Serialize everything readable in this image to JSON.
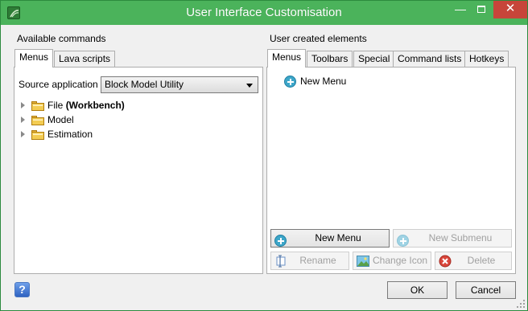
{
  "window": {
    "title": "User Interface Customisation",
    "minimize_glyph": "—",
    "close_glyph": "✕",
    "titlebar_color": "#4bb35b",
    "close_color": "#c7453a"
  },
  "left": {
    "section_label": "Available commands",
    "tabs": [
      {
        "label": "Menus",
        "active": true
      },
      {
        "label": "Lava scripts",
        "active": false
      }
    ],
    "source_label": "Source application",
    "source_value": "Block Model Utility",
    "tree": [
      {
        "label": "File",
        "suffix": "(Workbench)"
      },
      {
        "label": "Model",
        "suffix": ""
      },
      {
        "label": "Estimation",
        "suffix": ""
      }
    ]
  },
  "right": {
    "section_label": "User created elements",
    "tabs": [
      {
        "label": "Menus",
        "active": true
      },
      {
        "label": "Toolbars",
        "active": false
      },
      {
        "label": "Special",
        "active": false
      },
      {
        "label": "Command lists",
        "active": false
      },
      {
        "label": "Hotkeys",
        "active": false
      }
    ],
    "items": [
      {
        "label": "New Menu"
      }
    ],
    "buttons": {
      "new_menu": "New Menu",
      "new_submenu": "New Submenu",
      "rename": "Rename",
      "change_icon": "Change Icon",
      "delete": "Delete"
    }
  },
  "footer": {
    "help_glyph": "?",
    "ok": "OK",
    "cancel": "Cancel"
  }
}
